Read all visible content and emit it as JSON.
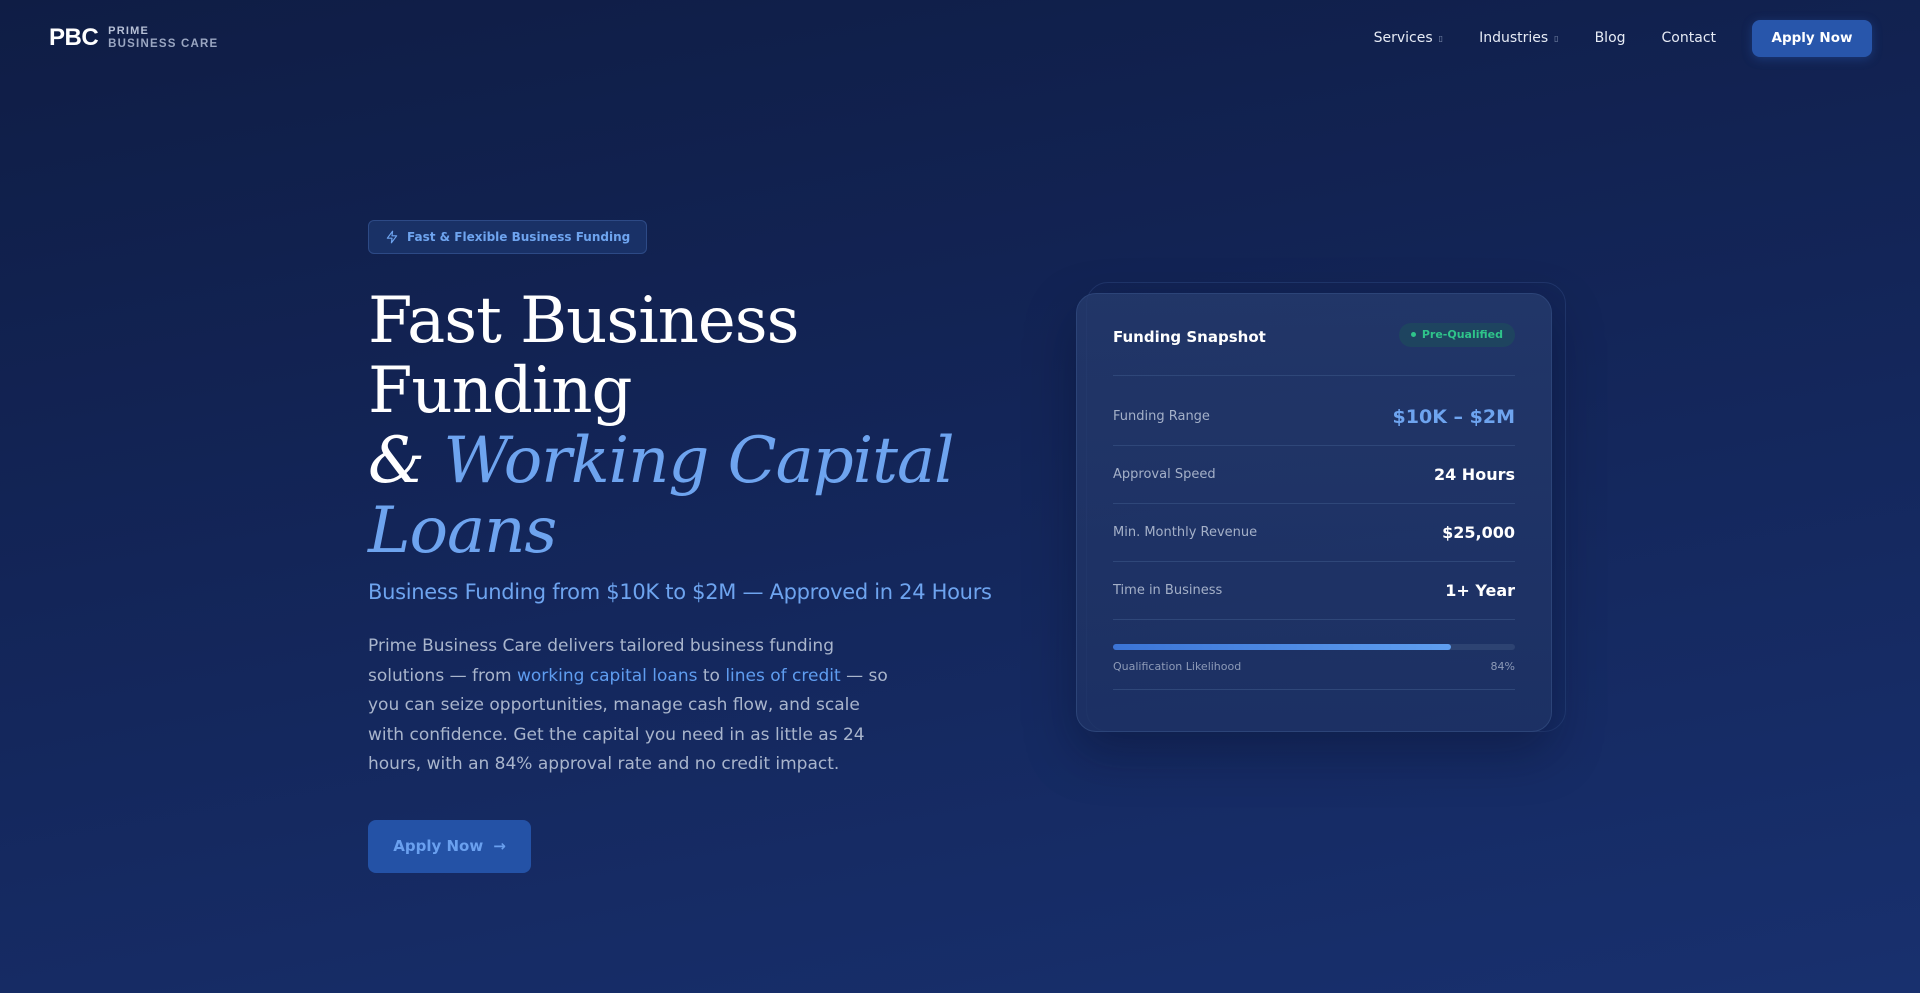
{
  "header": {
    "logo_mark": "PBC",
    "logo_line1": "PRIME",
    "logo_line2": "BUSINESS CARE",
    "nav": [
      {
        "label": "Services",
        "has_dropdown": true
      },
      {
        "label": "Industries",
        "has_dropdown": true
      },
      {
        "label": "Blog",
        "has_dropdown": false
      },
      {
        "label": "Contact",
        "has_dropdown": false
      }
    ],
    "cta_label": "Apply Now"
  },
  "hero": {
    "badge_icon": "lightning-icon",
    "badge_label": "Fast & Flexible Business Funding",
    "title_line1": "Fast Business Funding",
    "title_amp": "&",
    "title_accent_1": "Working Capital",
    "title_accent_2": "Loans",
    "subtitle": "Business Funding from $10K to $2M — Approved in 24 Hours",
    "desc_part1": "Prime Business Care delivers tailored business funding solutions — from ",
    "desc_link1": "working capital loans",
    "desc_part2": " to ",
    "desc_link2": "lines of credit",
    "desc_part3": " — so you can seize opportunities, manage cash flow, and scale with confidence. Get the capital you need in as little as 24 hours, with an 84% approval rate and no credit impact.",
    "cta_label": "Apply Now",
    "cta_icon": "arrow-right-icon"
  },
  "card": {
    "title": "Funding Snapshot",
    "status": "Pre-Qualified",
    "status_color": "#2fc48a",
    "rows": [
      {
        "label": "Funding Range",
        "value": "$10K – $2M"
      },
      {
        "label": "Approval Speed",
        "value": "24 Hours"
      },
      {
        "label": "Min. Monthly Revenue",
        "value": "$25,000"
      },
      {
        "label": "Time in Business",
        "value": "1+ Year"
      }
    ],
    "progress_label": "Qualification Likelihood",
    "progress_value": "84%",
    "progress_fraction": 0.84
  },
  "colors": {
    "accent": "#6ea4ef",
    "button": "#2856ab",
    "background": "#132558"
  }
}
